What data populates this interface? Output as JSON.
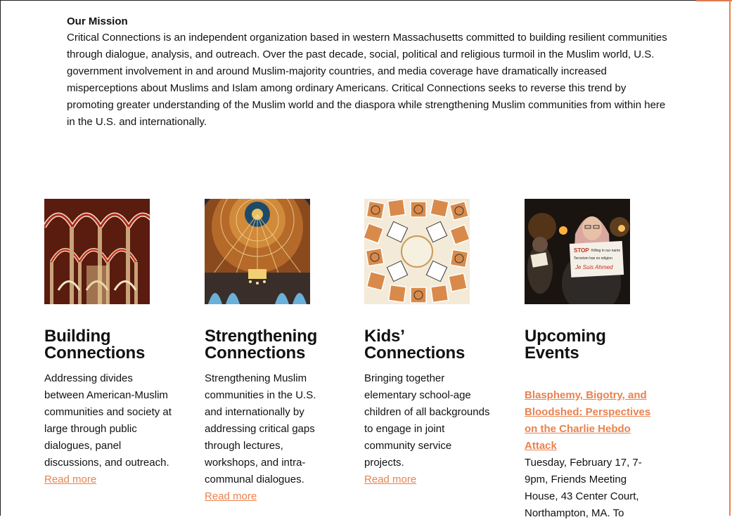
{
  "mission": {
    "title": "Our Mission",
    "text": "Critical Connections is an independent organization based in western Massachusetts committed to building resilient communities through dialogue, analysis, and outreach.  Over the past decade, social, political and religious turmoil in the Muslim world, U.S. government involvement in and around Muslim-majority countries, and media coverage have dramatically increased misperceptions about Muslims and Islam among ordinary Americans.  Critical Connections seeks to reverse this trend by promoting greater understanding of the Muslim world and the diaspora while strengthening Muslim communities from within here in the U.S. and internationally."
  },
  "columns": [
    {
      "title": "Building Connections",
      "desc": "Addressing divides between American-Muslim communities and society at large through public dialogues, panel discussions, and outreach.",
      "read_more": "Read more",
      "image_icon": "arches-photo"
    },
    {
      "title": "Strengthening Connections",
      "desc": "Strengthening Muslim communities in the U.S. and internationally by addressing critical gaps through lectures, workshops, and intra-communal dialogues.",
      "read_more": "Read more",
      "image_icon": "dome-photo"
    },
    {
      "title": "Kids’ Connections",
      "desc": "Bringing together elementary school-age children of all backgrounds to engage in joint community service projects.",
      "read_more": "Read more",
      "image_icon": "tiles-photo"
    },
    {
      "title": "Upcoming Events",
      "event_link": "Blasphemy, Bigotry, and Bloodshed: Perspectives on the Charlie Hebdo Attack",
      "event_details": "Tuesday, February 17, 7-9pm, Friends Meeting House, 43 Center Court, Northampton, MA. To",
      "image_icon": "protest-photo",
      "sign_text": "STOP Killing in our name / Terrorism has no religion / Je Suis Ahmed"
    }
  ],
  "colors": {
    "accent": "#e8824f",
    "text": "#111111"
  }
}
